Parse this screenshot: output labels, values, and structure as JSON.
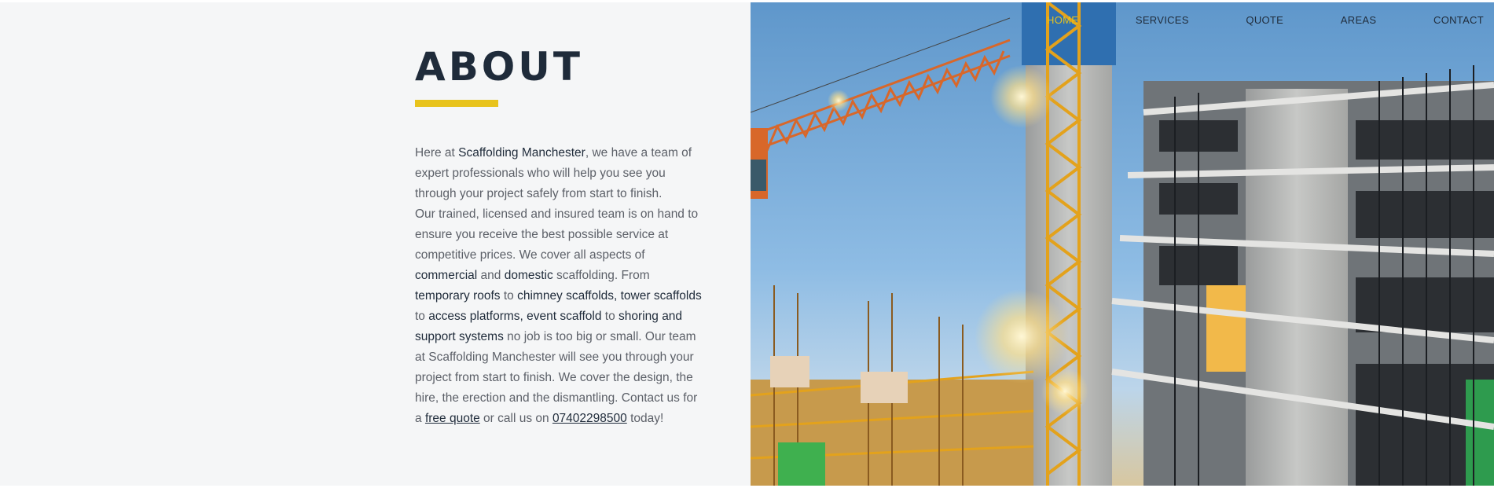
{
  "nav": {
    "items": [
      {
        "label": "HOME",
        "active": true
      },
      {
        "label": "SERVICES",
        "active": false
      },
      {
        "label": "QUOTE",
        "active": false
      },
      {
        "label": "AREAS",
        "active": false
      },
      {
        "label": "CONTACT",
        "active": false
      }
    ],
    "active_color": "#e8c31c",
    "text_color": "#1f2b3a"
  },
  "about": {
    "heading": "ABOUT",
    "underline_color": "#e8c31c",
    "p1_a": "Here at ",
    "p1_company": "Scaffolding Manchester",
    "p1_b": ", we have a team of expert professionals who will help you see you through your project safely from start to finish.",
    "p2_a": "Our trained, licensed and insured team is on hand to ensure you receive the best possible service at competitive prices. We cover all aspects of ",
    "p2_commercial": "commercial",
    "p2_and1": " and ",
    "p2_domestic": "domestic",
    "p2_b": " scaffolding. From ",
    "p2_temporary_roofs": "temporary roofs",
    "p2_to1": " to ",
    "p2_chimney": "chimney scaffolds, tower scaffolds",
    "p2_to2": " to ",
    "p2_access": "access platforms, event scaffold",
    "p2_to3": " to ",
    "p2_shoring": "shoring and support systems",
    "p2_c": " no job is too big or small. Our team at Scaffolding Manchester will see you through your project from start to finish. We cover the design, the hire, the erection and the dismantling. Contact us for a ",
    "p2_quote_link": "free quote",
    "p2_d": " or call us on ",
    "p2_phone_link": "07402298500",
    "p2_e": " today!"
  },
  "hero": {
    "image_subject": "construction-site-with-crane-and-scaffolding"
  },
  "colors": {
    "left_panel_bg": "#f5f6f7",
    "heading": "#1f2b3a",
    "body_text": "#5c6068",
    "accent": "#e8c31c"
  }
}
